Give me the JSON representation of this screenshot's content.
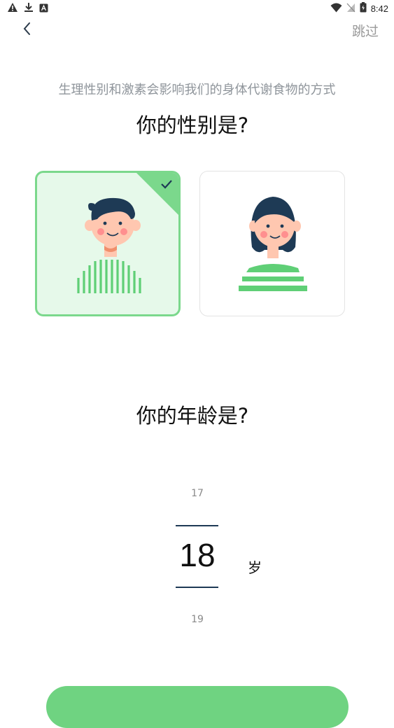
{
  "status_bar": {
    "time": "8:42",
    "left_icons": [
      "warning-icon",
      "download-icon",
      "app-notification-icon"
    ],
    "right_icons": [
      "wifi-icon",
      "no-sim-icon",
      "battery-icon"
    ]
  },
  "nav": {
    "back_icon": "chevron-left-icon",
    "skip_label": "跳过"
  },
  "gender_section": {
    "subtitle": "生理性别和激素会影响我们的身体代谢食物的方式",
    "question": "你的性别是?",
    "options": [
      {
        "id": "male",
        "selected": true,
        "accent": "#7bd88c",
        "background": "#e6f9ea"
      },
      {
        "id": "female",
        "selected": false
      }
    ]
  },
  "age_section": {
    "question": "你的年龄是?",
    "previous_value": "17",
    "current_value": "18",
    "next_value": "19",
    "unit": "岁"
  },
  "colors": {
    "accent_green": "#7bd88c",
    "button_green": "#6fd381",
    "picker_line": "#1e3a55",
    "hair": "#1e3a55",
    "skin": "#ffc7b0"
  }
}
